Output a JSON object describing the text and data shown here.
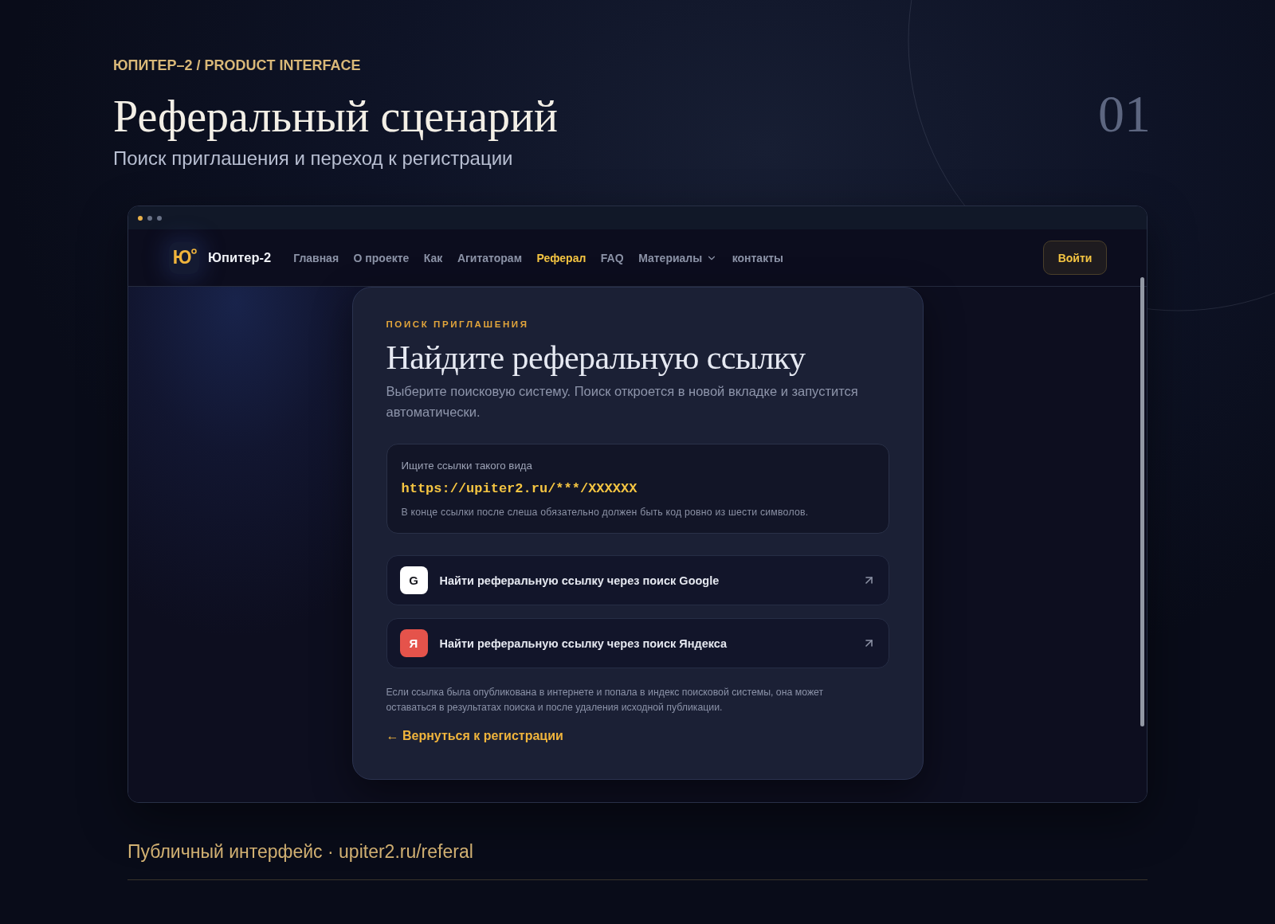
{
  "header": {
    "eyebrow": "ЮПИТЕР–2 / PRODUCT INTERFACE",
    "title": "Реферальный сценарий",
    "subtitle": "Поиск приглашения и переход к регистрации",
    "slide_number": "01"
  },
  "browser": {
    "window_dots": [
      {
        "color": "#e8b04a"
      },
      {
        "color": "#687186"
      },
      {
        "color": "#687186"
      }
    ],
    "navbar": {
      "logo": {
        "letter": "Ю"
      },
      "brand": "Юпитер-2",
      "links": [
        {
          "label": "Главная",
          "kind": "link",
          "selected": false
        },
        {
          "label": "О проекте",
          "kind": "link",
          "selected": false
        },
        {
          "label": "Как",
          "kind": "link",
          "selected": false
        },
        {
          "label": "Агитаторам",
          "kind": "link",
          "selected": false
        },
        {
          "label": "Реферал",
          "kind": "link",
          "selected": true
        },
        {
          "label": "FAQ",
          "kind": "link",
          "selected": false
        },
        {
          "label": "Материалы",
          "kind": "dropdown",
          "selected": false
        },
        {
          "label": "контакты",
          "kind": "link",
          "selected": false
        }
      ],
      "login_button": "Войти"
    },
    "card": {
      "eyebrow": "ПОИСК ПРИГЛАШЕНИЯ",
      "title": "Найдите реферальную ссылку",
      "description": "Выберите поисковую систему. Поиск откроется в новой вкладке и запустится автоматически.",
      "pattern_box": {
        "label": "Ищите ссылки такого вида",
        "pattern": "https://upiter2.ru/***/XXXXXX",
        "note": "В конце ссылки после слеша обязательно должен быть код ровно из шести символов."
      },
      "search_options": [
        {
          "kind": "google",
          "icon_letter": "G",
          "label": "Найти реферальную ссылку через поиск Google"
        },
        {
          "kind": "yandex",
          "icon_letter": "Я",
          "label": "Найти реферальную ссылку через поиск Яндекса"
        }
      ],
      "note": "Если ссылка была опубликована в интернете и попала в индекс поисковой системы, она может оставаться в результатах поиска и после удаления исходной публикации.",
      "back_link": "← Вернуться к регистрации"
    }
  },
  "footer": {
    "caption": "Публичный интерфейс · upiter2.ru/referal"
  }
}
